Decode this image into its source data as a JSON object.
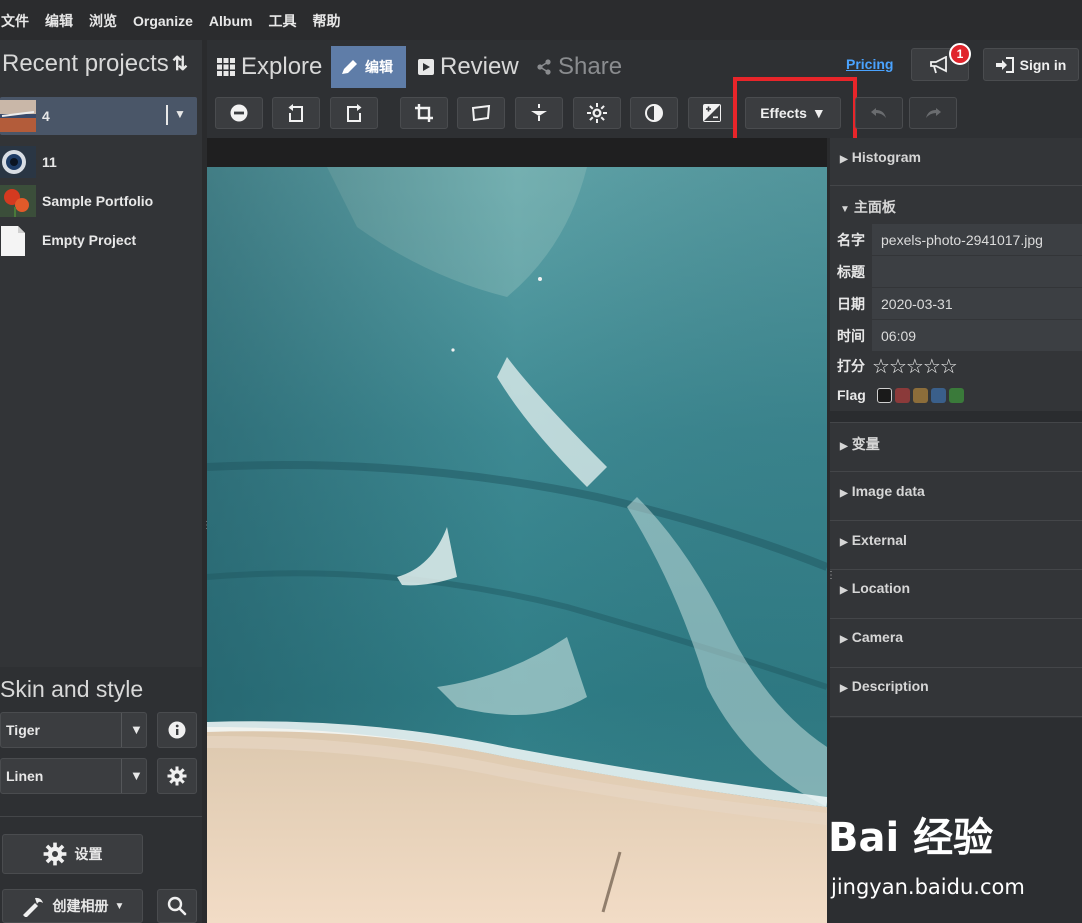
{
  "menu": [
    "文件",
    "编辑",
    "浏览",
    "Organize",
    "Album",
    "工具",
    "帮助"
  ],
  "left_panel": {
    "title": "Recent projects",
    "projects": [
      {
        "name": "4",
        "active": true
      },
      {
        "name": "11"
      },
      {
        "name": "Sample Portfolio"
      },
      {
        "name": "Empty Project"
      }
    ],
    "skin_title": "Skin and style",
    "skin_value": "Tiger",
    "style_value": "Linen",
    "settings_label": "设置",
    "create_album_label": "创建相册"
  },
  "tabs": {
    "explore": "Explore",
    "edit": "编辑",
    "review": "Review",
    "share": "Share"
  },
  "header": {
    "pricing": "Pricing",
    "notification_count": "1",
    "signin": "Sign in"
  },
  "toolbar": {
    "effects_label": "Effects"
  },
  "right_panel": {
    "histogram": "Histogram",
    "main_panel": "主面板",
    "fields": {
      "name_label": "名字",
      "name_value": "pexels-photo-2941017.jpg",
      "title_label": "标题",
      "title_value": "",
      "date_label": "日期",
      "date_value": "2020-03-31",
      "time_label": "时间",
      "time_value": "06:09",
      "rating_label": "打分",
      "rating_stars": 0,
      "rating_max": 5,
      "flag_label": "Flag"
    },
    "flag_colors": [
      "#1a1a1a",
      "#8b3a3a",
      "#8c6d3a",
      "#3a5f8a",
      "#3a7a3a"
    ],
    "sections": [
      "变量",
      "Image data",
      "External",
      "Location",
      "Camera",
      "Description"
    ]
  },
  "watermark": {
    "logo": "Bai 经验",
    "url": "jingyan.baidu.com"
  },
  "colors": {
    "accent": "#5f7da8",
    "highlight": "#e8252a",
    "link": "#4aa3ff"
  }
}
